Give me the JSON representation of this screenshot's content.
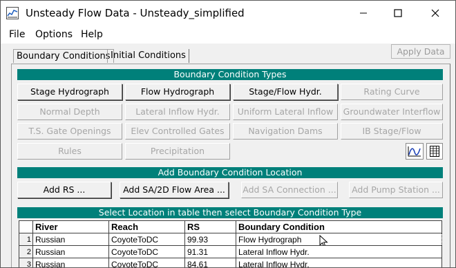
{
  "window": {
    "title": "Unsteady Flow Data - Unsteady_simplified"
  },
  "menu": {
    "file": "File",
    "options": "Options",
    "help": "Help"
  },
  "tabs": {
    "boundary": "Boundary Conditions",
    "initial": "Initial Conditions"
  },
  "apply_label": "Apply Data",
  "sections": {
    "types": "Boundary Condition Types",
    "add_location": "Add Boundary Condition Location",
    "table": "Select Location in table then select Boundary Condition Type"
  },
  "bc_types": {
    "stage_hydrograph": "Stage Hydrograph",
    "flow_hydrograph": "Flow Hydrograph",
    "stage_flow_hydr": "Stage/Flow Hydr.",
    "rating_curve": "Rating Curve",
    "normal_depth": "Normal Depth",
    "lateral_inflow_hydr": "Lateral Inflow Hydr.",
    "uniform_lateral_inflow": "Uniform Lateral Inflow",
    "groundwater_interflow": "Groundwater Interflow",
    "ts_gate_openings": "T.S. Gate Openings",
    "elev_controlled_gates": "Elev Controlled Gates",
    "navigation_dams": "Navigation Dams",
    "ib_stage_flow": "IB Stage/Flow",
    "rules": "Rules",
    "precipitation": "Precipitation"
  },
  "add_buttons": {
    "add_rs": "Add RS ...",
    "add_sa2d": "Add SA/2D Flow Area ...",
    "add_sa_connection": "Add SA Connection ...",
    "add_pump_station": "Add Pump Station ..."
  },
  "icons": {
    "plot": "line-chart-icon",
    "table": "table-grid-icon"
  },
  "colors": {
    "section_header": "#00807a",
    "disabled_text": "#a6a6a6"
  },
  "table": {
    "columns": {
      "river": "River",
      "reach": "Reach",
      "rs": "RS",
      "bc": "Boundary Condition"
    },
    "rows": [
      {
        "n": "1",
        "river": "Russian",
        "reach": "CoyoteToDC",
        "rs": "99.93",
        "bc": "Flow Hydrograph"
      },
      {
        "n": "2",
        "river": "Russian",
        "reach": "CoyoteToDC",
        "rs": "91.31",
        "bc": "Lateral Inflow Hydr."
      },
      {
        "n": "3",
        "river": "Russian",
        "reach": "CoyoteToDC",
        "rs": "84.61",
        "bc": "Lateral Inflow Hydr."
      }
    ]
  }
}
